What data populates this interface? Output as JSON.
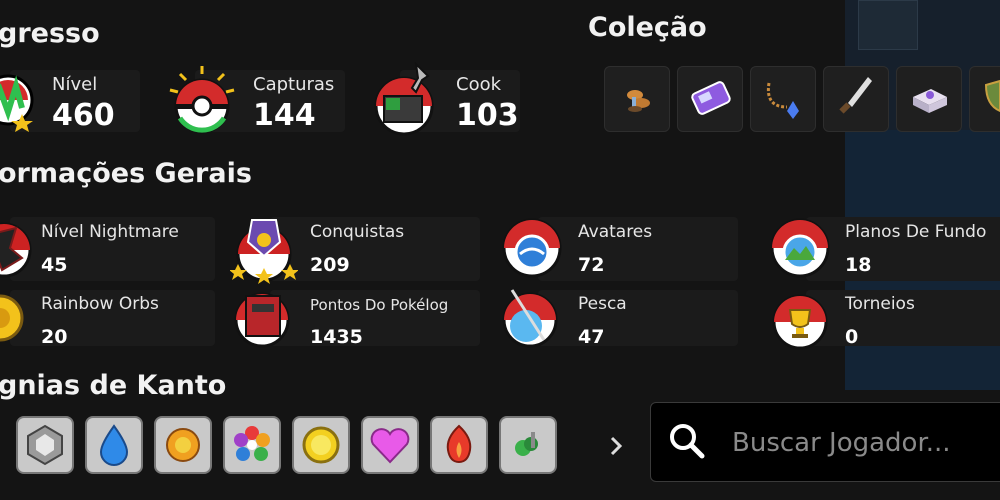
{
  "progress": {
    "title": "gresso",
    "stats": [
      {
        "label": "Nível",
        "value": "460",
        "icon": "level-icon"
      },
      {
        "label": "Capturas",
        "value": "144",
        "icon": "pokeball-icon"
      },
      {
        "label": "Cook",
        "value": "103",
        "icon": "cook-icon"
      }
    ]
  },
  "collection": {
    "title": "Coleção",
    "items": [
      "mushroom-icon",
      "purple-device-icon",
      "pendant-icon",
      "knife-icon",
      "crate-icon",
      "shield-icon"
    ]
  },
  "info": {
    "title": "ormações Gerais",
    "items": [
      {
        "label": "Nível Nightmare",
        "value": "45",
        "icon": "nightmare-icon"
      },
      {
        "label": "Conquistas",
        "value": "209",
        "icon": "medal-icon"
      },
      {
        "label": "Avatares",
        "value": "72",
        "icon": "avatar-icon"
      },
      {
        "label": "Planos De Fundo",
        "value": "18",
        "icon": "landscape-icon"
      },
      {
        "label": "Rainbow Orbs",
        "value": "20",
        "icon": "orb-icon"
      },
      {
        "label": "Pontos Do Pokélog",
        "value": "1435",
        "icon": "pokelog-icon"
      },
      {
        "label": "Pesca",
        "value": "47",
        "icon": "fishing-rod-icon"
      },
      {
        "label": "Torneios",
        "value": "0",
        "icon": "trophy-icon"
      }
    ]
  },
  "badges": {
    "title": "gnias de Kanto",
    "items": [
      "boulder-badge-icon",
      "cascade-badge-icon",
      "thunder-badge-icon",
      "rainbow-badge-icon",
      "soul-badge-icon",
      "marsh-badge-icon",
      "volcano-badge-icon",
      "earth-badge-icon"
    ]
  },
  "search": {
    "placeholder": "Buscar Jogador..."
  },
  "colors": {
    "background": "#141414",
    "pokeball_red": "#d32b2b",
    "badge_bg": "#c9c9c9"
  }
}
